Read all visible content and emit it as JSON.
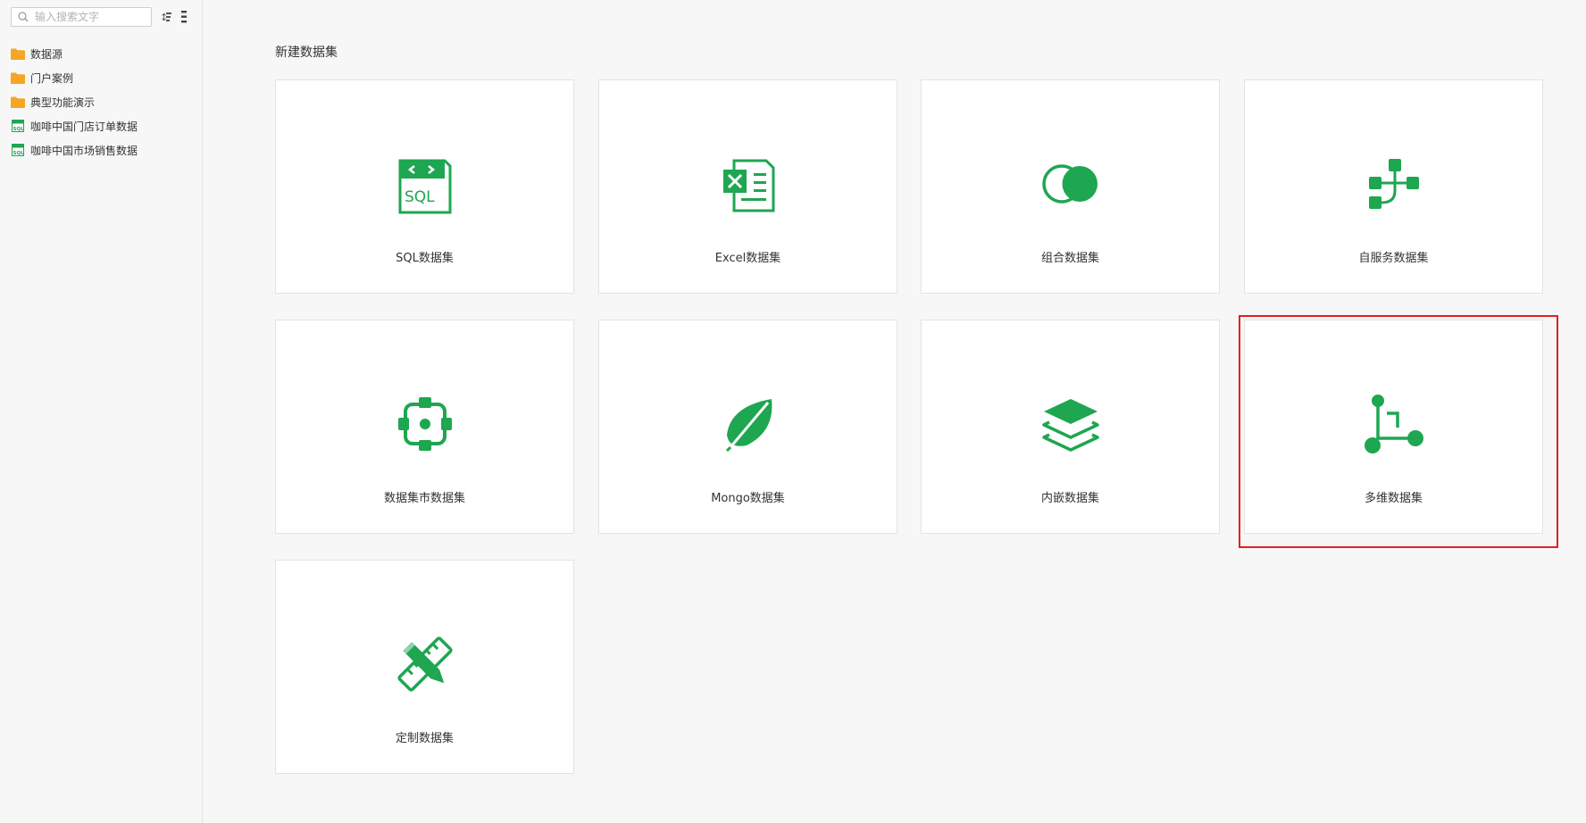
{
  "sidebar": {
    "search_placeholder": "输入搜索文字",
    "items": [
      {
        "label": "数据源",
        "icon": "folder-icon"
      },
      {
        "label": "门户案例",
        "icon": "folder-icon"
      },
      {
        "label": "典型功能演示",
        "icon": "folder-icon"
      },
      {
        "label": "咖啡中国门店订单数据",
        "icon": "sql-dataset-icon"
      },
      {
        "label": "咖啡中国市场销售数据",
        "icon": "sql-dataset-icon"
      }
    ]
  },
  "main": {
    "title": "新建数据集",
    "cards": [
      {
        "label": "SQL数据集",
        "icon": "sql-icon"
      },
      {
        "label": "Excel数据集",
        "icon": "excel-icon"
      },
      {
        "label": "组合数据集",
        "icon": "combined-icon"
      },
      {
        "label": "自服务数据集",
        "icon": "self-service-icon"
      },
      {
        "label": "数据集市数据集",
        "icon": "data-mart-icon"
      },
      {
        "label": "Mongo数据集",
        "icon": "mongo-leaf-icon"
      },
      {
        "label": "内嵌数据集",
        "icon": "layers-icon"
      },
      {
        "label": "多维数据集",
        "icon": "multidimensional-icon"
      },
      {
        "label": "定制数据集",
        "icon": "pencil-ruler-icon"
      }
    ],
    "highlighted_card": "多维数据集"
  },
  "colors": {
    "accent_green": "#1ea651",
    "folder_orange": "#f5a623",
    "highlight_red": "#e02020"
  }
}
